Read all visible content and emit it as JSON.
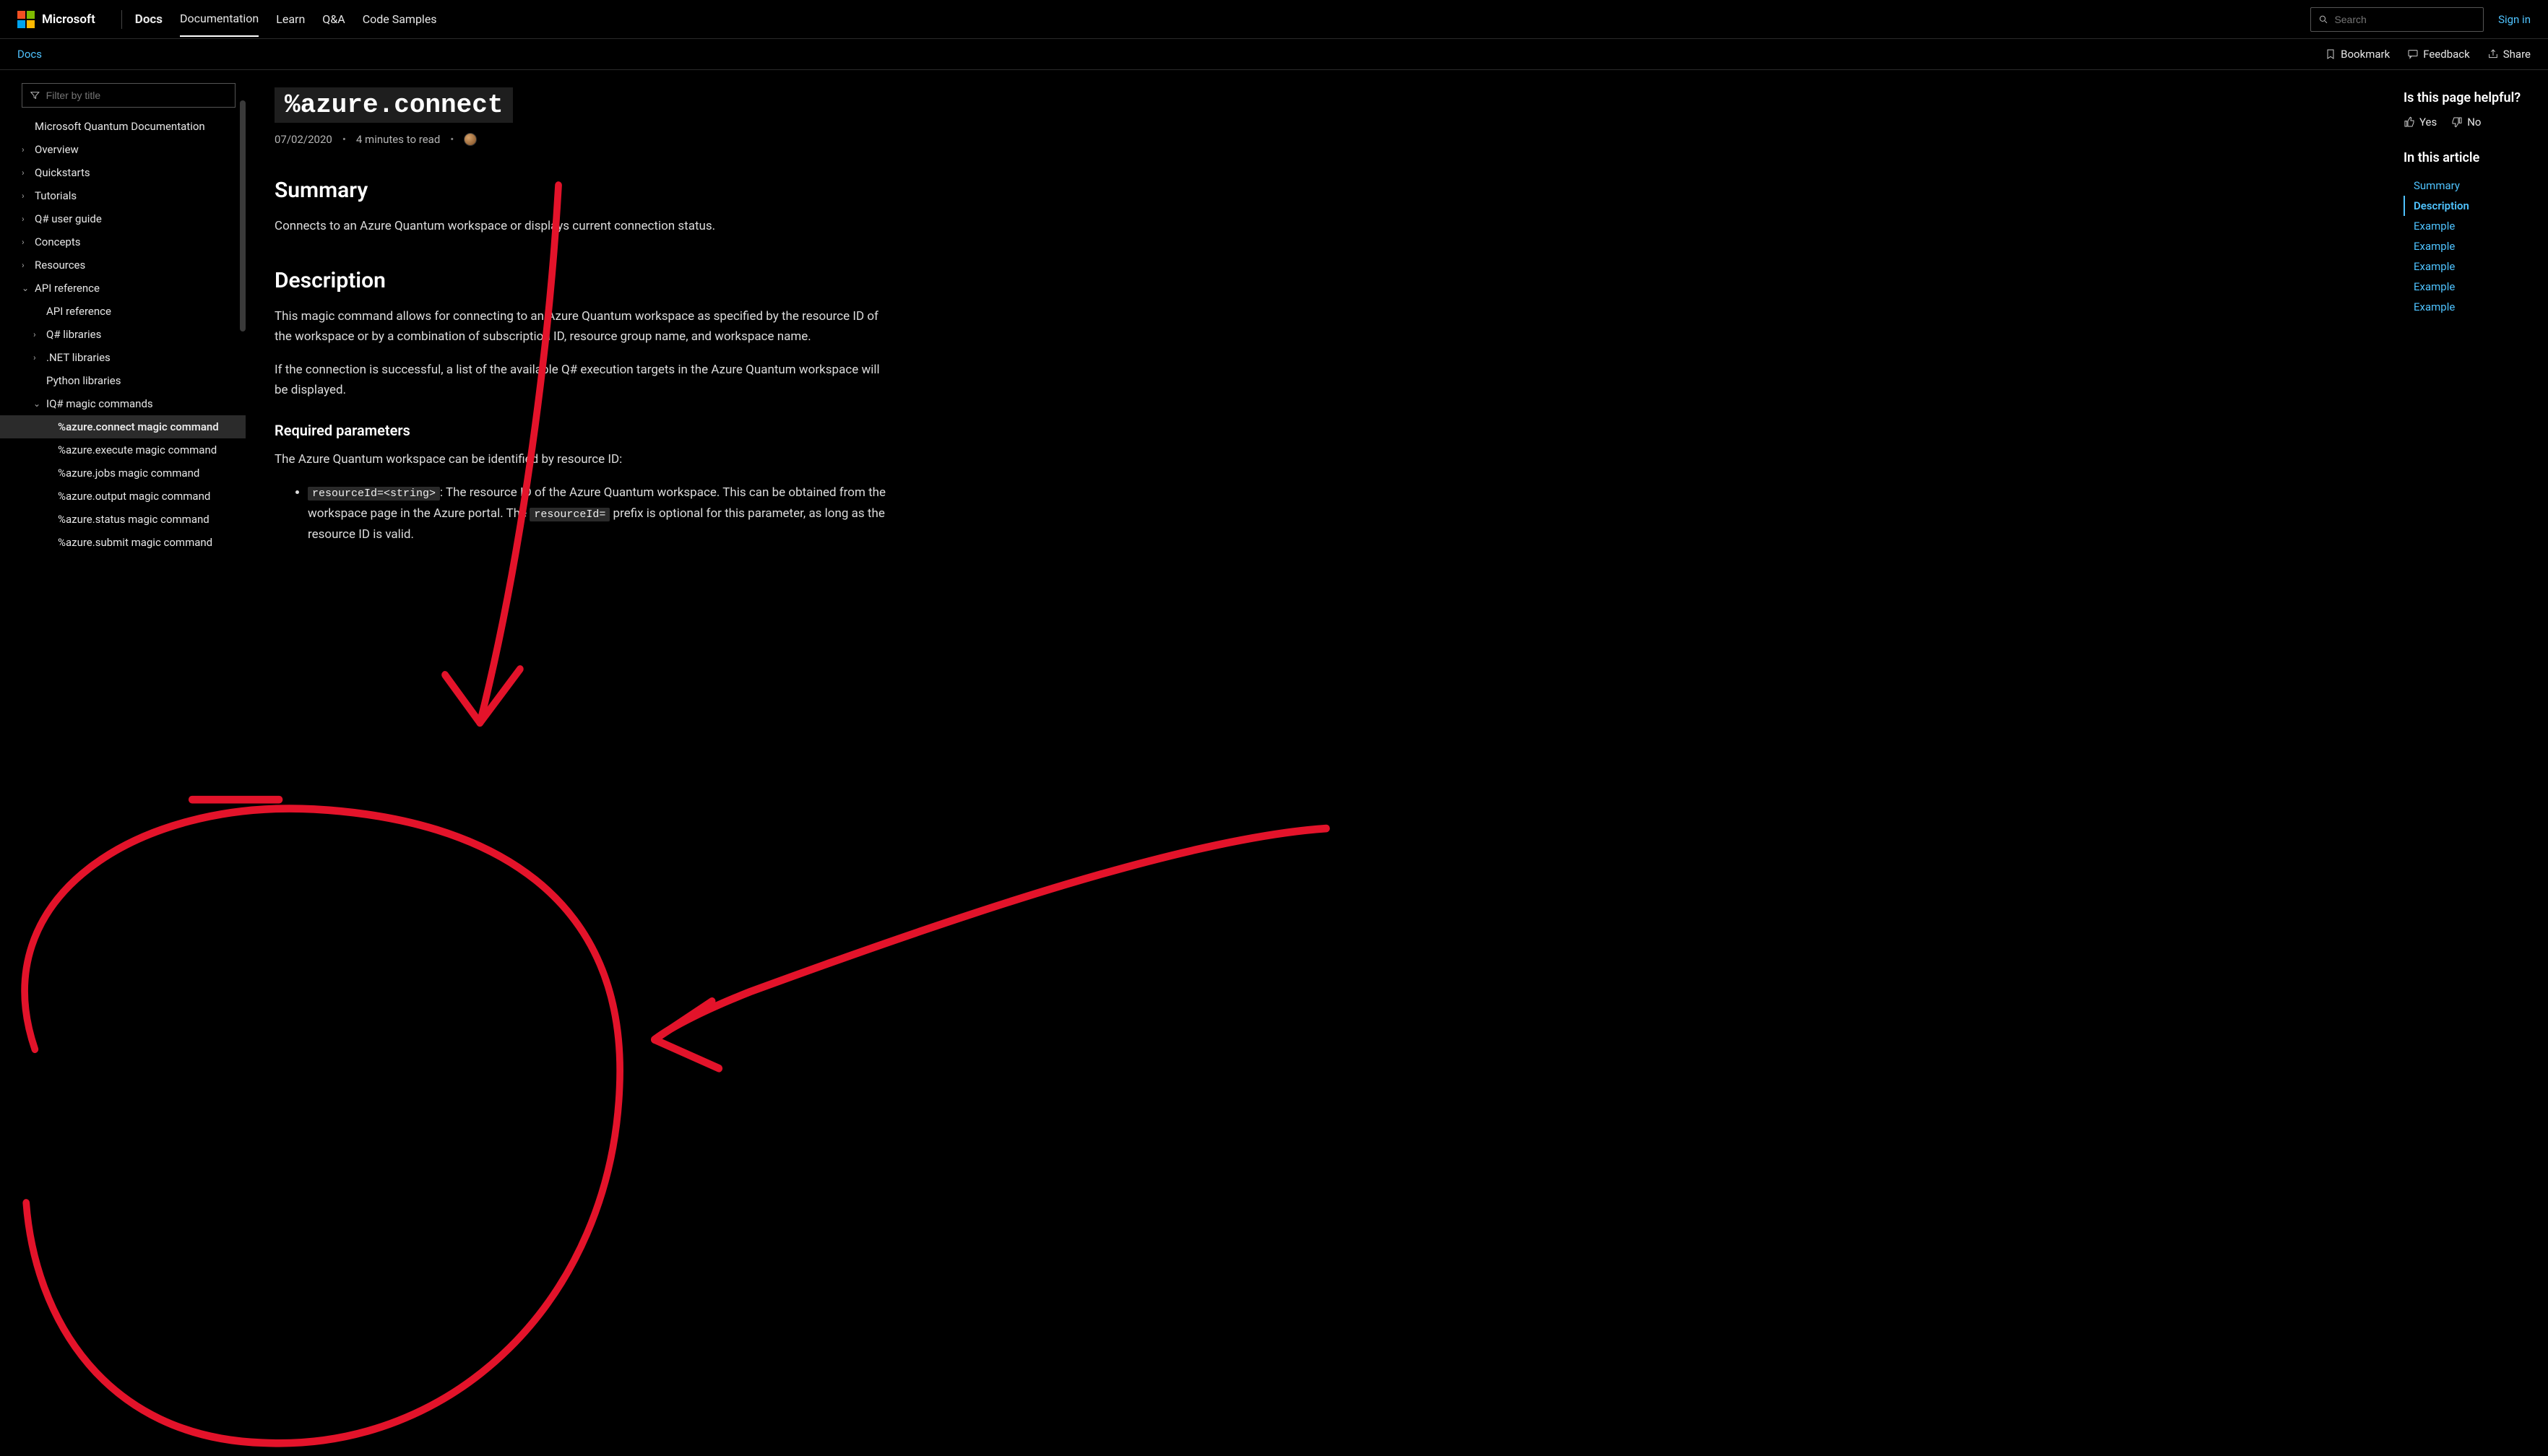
{
  "header": {
    "brand": "Microsoft",
    "product": "Docs",
    "nav": [
      "Documentation",
      "Learn",
      "Q&A",
      "Code Samples"
    ],
    "search_placeholder": "Search",
    "signin": "Sign in"
  },
  "subbar": {
    "breadcrumb": "Docs",
    "actions": {
      "bookmark": "Bookmark",
      "feedback": "Feedback",
      "share": "Share"
    }
  },
  "sidebar": {
    "filter_placeholder": "Filter by title",
    "items": [
      {
        "label": "Microsoft Quantum Documentation",
        "kind": "root"
      },
      {
        "label": "Overview",
        "kind": "root",
        "chev": ">"
      },
      {
        "label": "Quickstarts",
        "kind": "root",
        "chev": ">"
      },
      {
        "label": "Tutorials",
        "kind": "root",
        "chev": ">"
      },
      {
        "label": "Q# user guide",
        "kind": "root",
        "chev": ">"
      },
      {
        "label": "Concepts",
        "kind": "root",
        "chev": ">"
      },
      {
        "label": "Resources",
        "kind": "root",
        "chev": ">"
      },
      {
        "label": "API reference",
        "kind": "root",
        "chev": "v"
      },
      {
        "label": "API reference",
        "kind": "sub"
      },
      {
        "label": "Q# libraries",
        "kind": "sub",
        "chev": ">"
      },
      {
        "label": ".NET libraries",
        "kind": "sub",
        "chev": ">"
      },
      {
        "label": "Python libraries",
        "kind": "sub"
      },
      {
        "label": "IQ# magic commands",
        "kind": "sub",
        "chev": "v"
      },
      {
        "label": "%azure.connect magic command",
        "kind": "leaf",
        "selected": true
      },
      {
        "label": "%azure.execute magic command",
        "kind": "leaf"
      },
      {
        "label": "%azure.jobs magic command",
        "kind": "leaf"
      },
      {
        "label": "%azure.output magic command",
        "kind": "leaf"
      },
      {
        "label": "%azure.status magic command",
        "kind": "leaf"
      },
      {
        "label": "%azure.submit magic command",
        "kind": "leaf"
      }
    ]
  },
  "article": {
    "title": "%azure.connect",
    "date": "07/02/2020",
    "readtime": "4 minutes to read",
    "summary_h": "Summary",
    "summary_p": "Connects to an Azure Quantum workspace or displays current connection status.",
    "description_h": "Description",
    "description_p1": "This magic command allows for connecting to an Azure Quantum workspace as specified by the resource ID of the workspace or by a combination of subscription ID, resource group name, and workspace name.",
    "description_p2": "If the connection is successful, a list of the available Q# execution targets in the Azure Quantum workspace will be displayed.",
    "reqparams_h": "Required parameters",
    "reqparams_intro": "The Azure Quantum workspace can be identified by resource ID:",
    "bullet_code1": "resourceId=<string>",
    "bullet_text1a": ": The resource ID of the Azure Quantum workspace. This can be obtained from the workspace page in the Azure portal. The ",
    "bullet_code2": "resourceId=",
    "bullet_text1b": " prefix is optional for this parameter, as long as the resource ID is valid."
  },
  "rightrail": {
    "helpful_title": "Is this page helpful?",
    "yes": "Yes",
    "no": "No",
    "inthis_title": "In this article",
    "toc": [
      "Summary",
      "Description",
      "Example",
      "Example",
      "Example",
      "Example",
      "Example"
    ]
  }
}
